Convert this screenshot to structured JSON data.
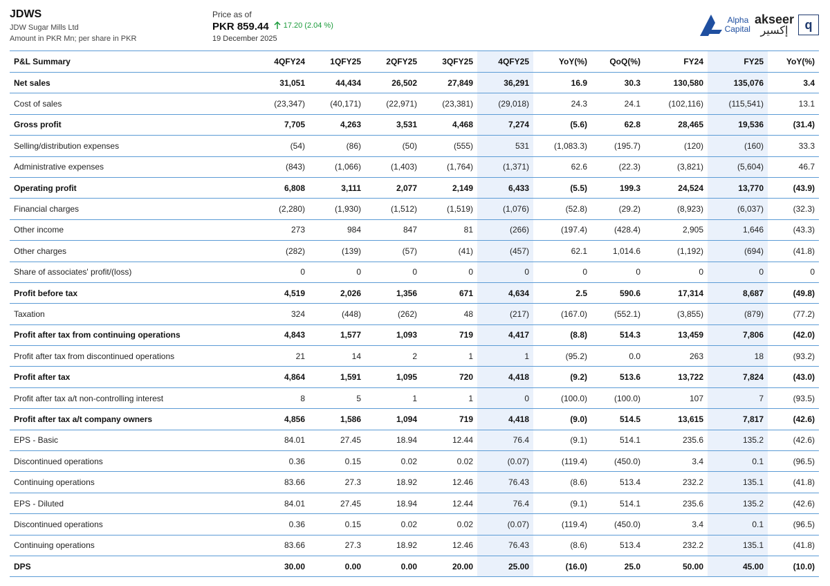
{
  "header": {
    "ticker": "JDWS",
    "company": "JDW Sugar Mills Ltd",
    "units": "Amount in PKR Mn; per share in PKR",
    "price_label": "Price as of",
    "price": "PKR 859.44",
    "change": "17.20 (2.04 %)",
    "date": "19 December 2025",
    "change_color": "#1a9a3a"
  },
  "logos": {
    "alpha_line1": "Alpha",
    "alpha_line2": "Capital",
    "akseer_en": "akseer",
    "akseer_ar": "إكسير",
    "akseer_box": "q"
  },
  "table": {
    "columns": [
      "P&L Summary",
      "4QFY24",
      "1QFY25",
      "2QFY25",
      "3QFY25",
      "4QFY25",
      "YoY(%)",
      "QoQ(%)",
      "FY24",
      "FY25",
      "YoY(%)"
    ],
    "highlight_color": "#eaf1fb",
    "rows": [
      {
        "label": "Net sales",
        "bold": true,
        "values": [
          "31,051",
          "44,434",
          "26,502",
          "27,849",
          "36,291",
          "16.9",
          "30.3",
          "130,580",
          "135,076",
          "3.4"
        ]
      },
      {
        "label": "Cost of sales",
        "bold": false,
        "values": [
          "(23,347)",
          "(40,171)",
          "(22,971)",
          "(23,381)",
          "(29,018)",
          "24.3",
          "24.1",
          "(102,116)",
          "(115,541)",
          "13.1"
        ]
      },
      {
        "label": "Gross profit",
        "bold": true,
        "values": [
          "7,705",
          "4,263",
          "3,531",
          "4,468",
          "7,274",
          "(5.6)",
          "62.8",
          "28,465",
          "19,536",
          "(31.4)"
        ]
      },
      {
        "label": "Selling/distribution expenses",
        "bold": false,
        "values": [
          "(54)",
          "(86)",
          "(50)",
          "(555)",
          "531",
          "(1,083.3)",
          "(195.7)",
          "(120)",
          "(160)",
          "33.3"
        ]
      },
      {
        "label": "Administrative expenses",
        "bold": false,
        "values": [
          "(843)",
          "(1,066)",
          "(1,403)",
          "(1,764)",
          "(1,371)",
          "62.6",
          "(22.3)",
          "(3,821)",
          "(5,604)",
          "46.7"
        ]
      },
      {
        "label": "Operating profit",
        "bold": true,
        "values": [
          "6,808",
          "3,111",
          "2,077",
          "2,149",
          "6,433",
          "(5.5)",
          "199.3",
          "24,524",
          "13,770",
          "(43.9)"
        ]
      },
      {
        "label": "Financial charges",
        "bold": false,
        "values": [
          "(2,280)",
          "(1,930)",
          "(1,512)",
          "(1,519)",
          "(1,076)",
          "(52.8)",
          "(29.2)",
          "(8,923)",
          "(6,037)",
          "(32.3)"
        ]
      },
      {
        "label": "Other income",
        "bold": false,
        "values": [
          "273",
          "984",
          "847",
          "81",
          "(266)",
          "(197.4)",
          "(428.4)",
          "2,905",
          "1,646",
          "(43.3)"
        ]
      },
      {
        "label": "Other charges",
        "bold": false,
        "values": [
          "(282)",
          "(139)",
          "(57)",
          "(41)",
          "(457)",
          "62.1",
          "1,014.6",
          "(1,192)",
          "(694)",
          "(41.8)"
        ]
      },
      {
        "label": "Share of associates' profit/(loss)",
        "bold": false,
        "values": [
          "0",
          "0",
          "0",
          "0",
          "0",
          "0",
          "0",
          "0",
          "0",
          "0"
        ]
      },
      {
        "label": "Profit before tax",
        "bold": true,
        "values": [
          "4,519",
          "2,026",
          "1,356",
          "671",
          "4,634",
          "2.5",
          "590.6",
          "17,314",
          "8,687",
          "(49.8)"
        ]
      },
      {
        "label": "Taxation",
        "bold": false,
        "values": [
          "324",
          "(448)",
          "(262)",
          "48",
          "(217)",
          "(167.0)",
          "(552.1)",
          "(3,855)",
          "(879)",
          "(77.2)"
        ]
      },
      {
        "label": "Profit after tax from continuing operations",
        "bold": true,
        "values": [
          "4,843",
          "1,577",
          "1,093",
          "719",
          "4,417",
          "(8.8)",
          "514.3",
          "13,459",
          "7,806",
          "(42.0)"
        ]
      },
      {
        "label": "Profit after tax from discontinued operations",
        "bold": false,
        "values": [
          "21",
          "14",
          "2",
          "1",
          "1",
          "(95.2)",
          "0.0",
          "263",
          "18",
          "(93.2)"
        ]
      },
      {
        "label": "Profit after tax",
        "bold": true,
        "values": [
          "4,864",
          "1,591",
          "1,095",
          "720",
          "4,418",
          "(9.2)",
          "513.6",
          "13,722",
          "7,824",
          "(43.0)"
        ]
      },
      {
        "label": "Profit after tax a/t non-controlling interest",
        "bold": false,
        "values": [
          "8",
          "5",
          "1",
          "1",
          "0",
          "(100.0)",
          "(100.0)",
          "107",
          "7",
          "(93.5)"
        ]
      },
      {
        "label": "Profit after tax a/t company owners",
        "bold": true,
        "values": [
          "4,856",
          "1,586",
          "1,094",
          "719",
          "4,418",
          "(9.0)",
          "514.5",
          "13,615",
          "7,817",
          "(42.6)"
        ]
      },
      {
        "label": "EPS - Basic",
        "bold": false,
        "values": [
          "84.01",
          "27.45",
          "18.94",
          "12.44",
          "76.4",
          "(9.1)",
          "514.1",
          "235.6",
          "135.2",
          "(42.6)"
        ]
      },
      {
        "label": "Discontinued operations",
        "bold": false,
        "values": [
          "0.36",
          "0.15",
          "0.02",
          "0.02",
          "(0.07)",
          "(119.4)",
          "(450.0)",
          "3.4",
          "0.1",
          "(96.5)"
        ]
      },
      {
        "label": "Continuing operations",
        "bold": false,
        "values": [
          "83.66",
          "27.3",
          "18.92",
          "12.46",
          "76.43",
          "(8.6)",
          "513.4",
          "232.2",
          "135.1",
          "(41.8)"
        ]
      },
      {
        "label": "EPS - Diluted",
        "bold": false,
        "values": [
          "84.01",
          "27.45",
          "18.94",
          "12.44",
          "76.4",
          "(9.1)",
          "514.1",
          "235.6",
          "135.2",
          "(42.6)"
        ]
      },
      {
        "label": "Discontinued operations",
        "bold": false,
        "values": [
          "0.36",
          "0.15",
          "0.02",
          "0.02",
          "(0.07)",
          "(119.4)",
          "(450.0)",
          "3.4",
          "0.1",
          "(96.5)"
        ]
      },
      {
        "label": "Continuing operations",
        "bold": false,
        "values": [
          "83.66",
          "27.3",
          "18.92",
          "12.46",
          "76.43",
          "(8.6)",
          "513.4",
          "232.2",
          "135.1",
          "(41.8)"
        ]
      },
      {
        "label": "DPS",
        "bold": true,
        "values": [
          "30.00",
          "0.00",
          "0.00",
          "20.00",
          "25.00",
          "(16.0)",
          "25.0",
          "50.00",
          "45.00",
          "(10.0)"
        ]
      }
    ]
  }
}
